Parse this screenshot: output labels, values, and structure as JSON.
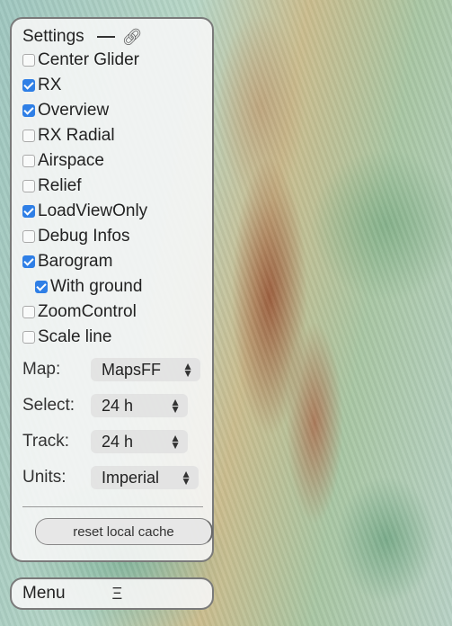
{
  "settings": {
    "title": "Settings",
    "options": [
      {
        "label": "Center Glider",
        "checked": false
      },
      {
        "label": "RX",
        "checked": true
      },
      {
        "label": "Overview",
        "checked": true
      },
      {
        "label": "RX Radial",
        "checked": false
      },
      {
        "label": "Airspace",
        "checked": false
      },
      {
        "label": "Relief",
        "checked": false
      },
      {
        "label": "LoadViewOnly",
        "checked": true
      },
      {
        "label": "Debug Infos",
        "checked": false
      },
      {
        "label": "Barogram",
        "checked": true
      },
      {
        "label": "With ground",
        "checked": true,
        "sub": true
      },
      {
        "label": "ZoomControl",
        "checked": false
      },
      {
        "label": "Scale line",
        "checked": false
      }
    ],
    "selects": [
      {
        "label": "Map:",
        "value": "MapsFF"
      },
      {
        "label": "Select:",
        "value": "24 h"
      },
      {
        "label": "Track:",
        "value": "24 h"
      },
      {
        "label": "Units:",
        "value": "Imperial"
      }
    ],
    "reset_label": "reset local cache"
  },
  "menu": {
    "label": "Menu",
    "icon": "menu-icon",
    "glyph": "Ξ"
  }
}
